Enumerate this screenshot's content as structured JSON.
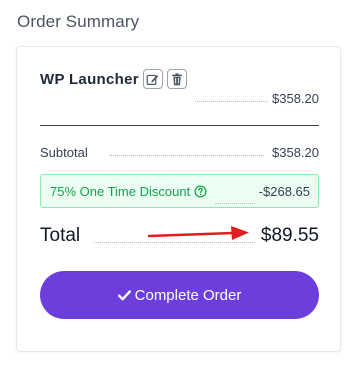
{
  "summary": {
    "title": "Order Summary"
  },
  "product": {
    "name": "WP Launcher",
    "price": "$358.20",
    "edit_icon": "edit-icon",
    "delete_icon": "trash-icon"
  },
  "subtotal": {
    "label": "Subtotal",
    "value": "$358.20"
  },
  "discount": {
    "label": "75% One Time Discount",
    "value": "-$268.65",
    "help_icon": "question-circle-icon",
    "accent": "#16a34a",
    "background": "#ecfdf3"
  },
  "total": {
    "label": "Total",
    "value": "$89.55"
  },
  "cta": {
    "label": "Complete Order",
    "icon": "check-icon",
    "color": "#6c3fdc"
  },
  "annotation": {
    "arrow_color": "#e11d1d"
  }
}
